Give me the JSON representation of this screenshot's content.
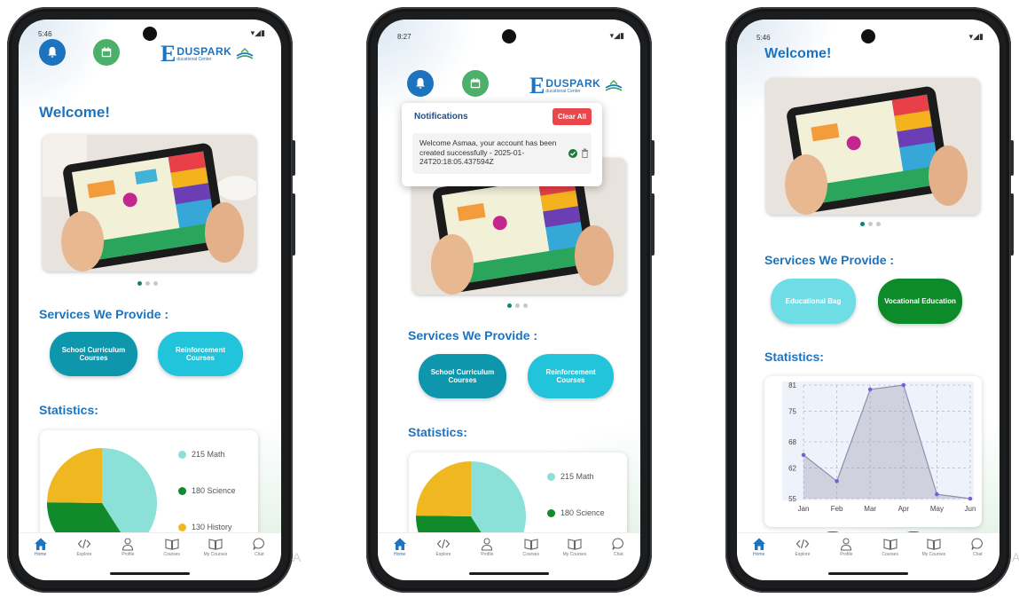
{
  "status": {
    "left_time": "5:46",
    "mid_time": "8:27",
    "right_time": "5:46"
  },
  "logo": {
    "big_letter": "E",
    "word": "DUSPARK",
    "subtitle": "ducational Center"
  },
  "welcome": "Welcome!",
  "services": {
    "title": "Services We Provide :",
    "school": "School Curriculum Courses",
    "reinforcement": "Reinforcement Courses",
    "bag": "Educational Bag",
    "vocational": "Vocational Education"
  },
  "statistics": {
    "title": "Statistics:",
    "legend": [
      {
        "value": "215 Math",
        "color": "#8be0d8"
      },
      {
        "value": "180 Science",
        "color": "#108a2a"
      },
      {
        "value": "130 History",
        "color": "#f0b820"
      }
    ]
  },
  "notifications": {
    "title": "Notifications",
    "clear_label": "Clear All",
    "message": "Welcome Asmaa, your account has been created successfully - 2025-01-24T20:18:05.437594Z"
  },
  "nav": {
    "home": "Home",
    "explore": "Explore",
    "profile": "Profile",
    "courses": "Courses",
    "my_courses": "My Courses",
    "chat": "Chat"
  },
  "colors": {
    "brand_blue": "#1e73be",
    "teal": "#0e96ad",
    "cyan": "#22c4dc",
    "green": "#0d8b2a",
    "light_cyan": "#6fdde6"
  },
  "chart_data": [
    {
      "type": "pie",
      "title": "",
      "categories": [
        "Math",
        "Science",
        "History"
      ],
      "values": [
        215,
        180,
        130
      ],
      "colors": [
        "#8be0d8",
        "#108a2a",
        "#f0b820"
      ]
    },
    {
      "type": "area",
      "title": "",
      "categories": [
        "Jan",
        "Feb",
        "Mar",
        "Apr",
        "May",
        "Jun"
      ],
      "values": [
        65,
        59,
        80,
        81,
        56,
        55
      ],
      "y_ticks": [
        55,
        62,
        68,
        75,
        81
      ],
      "ylim": [
        55,
        81
      ],
      "grid": true
    }
  ]
}
